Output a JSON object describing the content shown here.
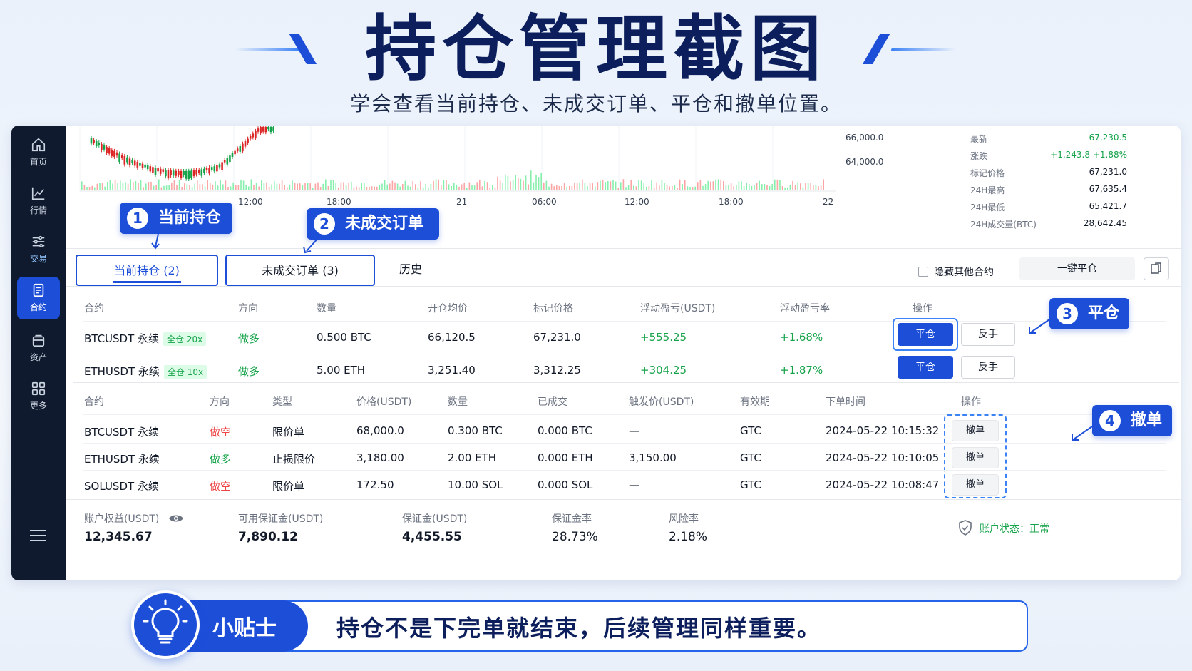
{
  "header": {
    "title": "持仓管理截图",
    "subtitle": "学会查看当前持仓、未成交订单、平仓和撤单位置。"
  },
  "sidebar": {
    "items": [
      {
        "label": "首页",
        "icon": "home-icon"
      },
      {
        "label": "行情",
        "icon": "chart-icon"
      },
      {
        "label": "交易",
        "icon": "sliders-icon"
      },
      {
        "label": "合约",
        "icon": "document-icon"
      },
      {
        "label": "资产",
        "icon": "bag-icon"
      },
      {
        "label": "更多",
        "icon": "grid-icon"
      }
    ],
    "active": "合约"
  },
  "chart": {
    "y_ticks": [
      "66,000.0",
      "64,000.0"
    ],
    "x_ticks": [
      "12:00",
      "18:00",
      "21",
      "06:00",
      "12:00",
      "18:00",
      "22"
    ]
  },
  "ticker": {
    "rows": [
      {
        "label": "最新",
        "value": "67,230.5",
        "color": "#16a34a"
      },
      {
        "label": "涨跌",
        "value": "+1,243.8  +1.88%",
        "color": "#16a34a"
      },
      {
        "label": "标记价格",
        "value": "67,231.0",
        "color": "#111827"
      },
      {
        "label": "24H最高",
        "value": "67,635.4",
        "color": "#111827"
      },
      {
        "label": "24H最低",
        "value": "65,421.7",
        "color": "#111827"
      },
      {
        "label": "24H成交量(BTC)",
        "value": "28,642.45",
        "color": "#111827"
      }
    ]
  },
  "tabs": {
    "positions": "当前持仓 (2)",
    "open_orders": "未成交订单 (3)",
    "history": "历史",
    "hide_other": "隐藏其他合约",
    "close_all": "一键平仓"
  },
  "positions": {
    "headers": [
      "合约",
      "方向",
      "数量",
      "开仓均价",
      "标记价格",
      "浮动盈亏(USDT)",
      "浮动盈亏率",
      "操作"
    ],
    "rows": [
      {
        "symbol": "BTCUSDT 永续",
        "margin": "全仓 20x",
        "side": "做多",
        "qty": "0.500 BTC",
        "entry": "66,120.5",
        "mark": "67,231.0",
        "pnl": "+555.25",
        "pnl_rate": "+1.68%",
        "close": "平仓",
        "reverse": "反手"
      },
      {
        "symbol": "ETHUSDT 永续",
        "margin": "全仓 10x",
        "side": "做多",
        "qty": "5.00 ETH",
        "entry": "3,251.40",
        "mark": "3,312.25",
        "pnl": "+304.25",
        "pnl_rate": "+1.87%",
        "close": "平仓",
        "reverse": "反手"
      }
    ]
  },
  "orders": {
    "headers": [
      "合约",
      "方向",
      "类型",
      "价格(USDT)",
      "数量",
      "已成交",
      "触发价(USDT)",
      "有效期",
      "下单时间",
      "操作"
    ],
    "rows": [
      {
        "symbol": "BTCUSDT 永续",
        "side": "做空",
        "side_color": "#ef4444",
        "type": "限价单",
        "price": "68,000.0",
        "qty": "0.300 BTC",
        "filled": "0.000 BTC",
        "trigger": "—",
        "tif": "GTC",
        "time": "2024-05-22 10:15:32",
        "action": "撤单"
      },
      {
        "symbol": "ETHUSDT 永续",
        "side": "做多",
        "side_color": "#16a34a",
        "type": "止损限价",
        "price": "3,180.00",
        "qty": "2.00 ETH",
        "filled": "0.000 ETH",
        "trigger": "3,150.00",
        "tif": "GTC",
        "time": "2024-05-22 10:10:05",
        "action": "撤单"
      },
      {
        "symbol": "SOLUSDT 永续",
        "side": "做空",
        "side_color": "#ef4444",
        "type": "限价单",
        "price": "172.50",
        "qty": "10.00 SOL",
        "filled": "0.000 SOL",
        "trigger": "—",
        "tif": "GTC",
        "time": "2024-05-22 10:08:47",
        "action": "撤单"
      }
    ]
  },
  "account": {
    "equity_label": "账户权益(USDT)",
    "equity": "12,345.67",
    "available_label": "可用保证金(USDT)",
    "available": "7,890.12",
    "margin_label": "保证金(USDT)",
    "margin": "4,455.55",
    "margin_rate_label": "保证金率",
    "margin_rate": "28.73%",
    "risk_label": "风险率",
    "risk": "2.18%",
    "status": "账户状态：正常"
  },
  "callouts": [
    {
      "num": "1",
      "text": "当前持仓"
    },
    {
      "num": "2",
      "text": "未成交订单"
    },
    {
      "num": "3",
      "text": "平仓"
    },
    {
      "num": "4",
      "text": "撤单"
    }
  ],
  "tip": {
    "label": "小贴士",
    "text": "持仓不是下完单就结束，后续管理同样重要。"
  },
  "colors": {
    "accent": "#1d4ed8",
    "up": "#16a34a",
    "down": "#ef4444",
    "title": "#0c1f5c"
  }
}
